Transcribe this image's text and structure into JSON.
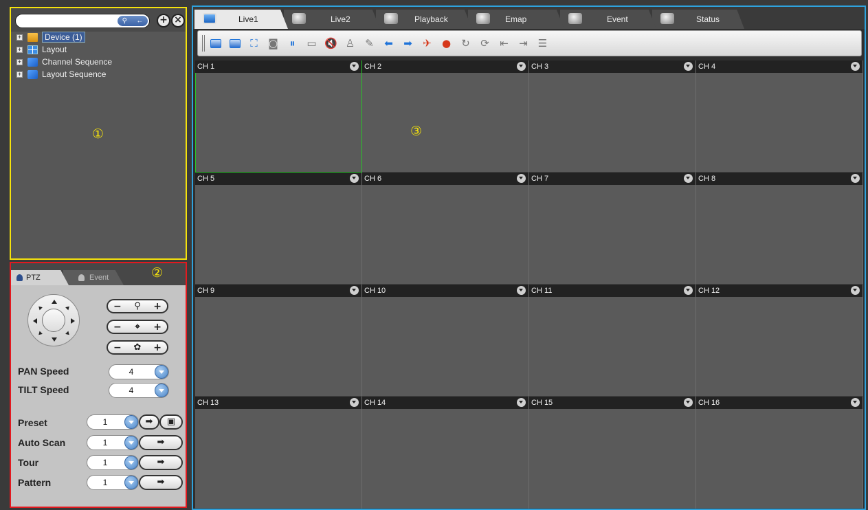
{
  "markers": {
    "one": "①",
    "two": "②",
    "three": "③"
  },
  "tree": {
    "search_placeholder": "",
    "search_icon": "search-icon",
    "back_icon": "back-arrow-icon",
    "add_icon": "add-circle-icon",
    "remove_icon": "close-circle-icon",
    "items": [
      {
        "label": "Device (1)",
        "icon": "folder-icon",
        "selected": true
      },
      {
        "label": "Layout",
        "icon": "layout-icon"
      },
      {
        "label": "Channel Sequence",
        "icon": "sequence-icon"
      },
      {
        "label": "Layout Sequence",
        "icon": "sequence-icon"
      }
    ]
  },
  "ptz": {
    "tabs": [
      {
        "label": "PTZ",
        "active": true
      },
      {
        "label": "Event",
        "active": false
      }
    ],
    "zoom": {
      "minus": "−",
      "plus": "+",
      "icon": "magnifier-icon"
    },
    "focus": {
      "minus": "−",
      "plus": "+",
      "icon": "crosshair-icon"
    },
    "iris": {
      "minus": "−",
      "plus": "+",
      "icon": "iris-icon"
    },
    "pan_speed": {
      "label": "PAN Speed",
      "value": "4"
    },
    "tilt_speed": {
      "label": "TILT Speed",
      "value": "4"
    },
    "preset": {
      "label": "Preset",
      "value": "1",
      "go": "➡",
      "save": "▣"
    },
    "auto_scan": {
      "label": "Auto Scan",
      "value": "1",
      "go": "➡"
    },
    "tour": {
      "label": "Tour",
      "value": "1",
      "go": "➡"
    },
    "pattern": {
      "label": "Pattern",
      "value": "1",
      "go": "➡"
    }
  },
  "main_tabs": [
    {
      "label": "Live1",
      "icon": "monitor-icon",
      "active": true
    },
    {
      "label": "Live2",
      "icon": "monitor-icon",
      "active": false
    },
    {
      "label": "Playback",
      "icon": "playback-icon",
      "active": false
    },
    {
      "label": "Emap",
      "icon": "emap-icon",
      "active": false
    },
    {
      "label": "Event",
      "icon": "event-icon",
      "active": false
    },
    {
      "label": "Status",
      "icon": "status-icon",
      "active": false
    }
  ],
  "toolbar": [
    "layout-16-icon",
    "layout-4-icon",
    "fullscreen-icon",
    "snapshot-icon",
    "pause-icon",
    "record-icon",
    "mute-icon",
    "mic-mute-icon",
    "edit-icon",
    "previous-icon",
    "next-icon",
    "alarm-icon",
    "emergency-icon",
    "refresh-icon",
    "schedule-icon",
    "sequence-back-icon",
    "sequence-forward-icon",
    "layout-list-icon"
  ],
  "channels": [
    "CH 1",
    "CH 2",
    "CH 3",
    "CH 4",
    "CH 5",
    "CH 6",
    "CH 7",
    "CH 8",
    "CH 9",
    "CH 10",
    "CH 11",
    "CH 12",
    "CH 13",
    "CH 14",
    "CH 15",
    "CH 16"
  ]
}
